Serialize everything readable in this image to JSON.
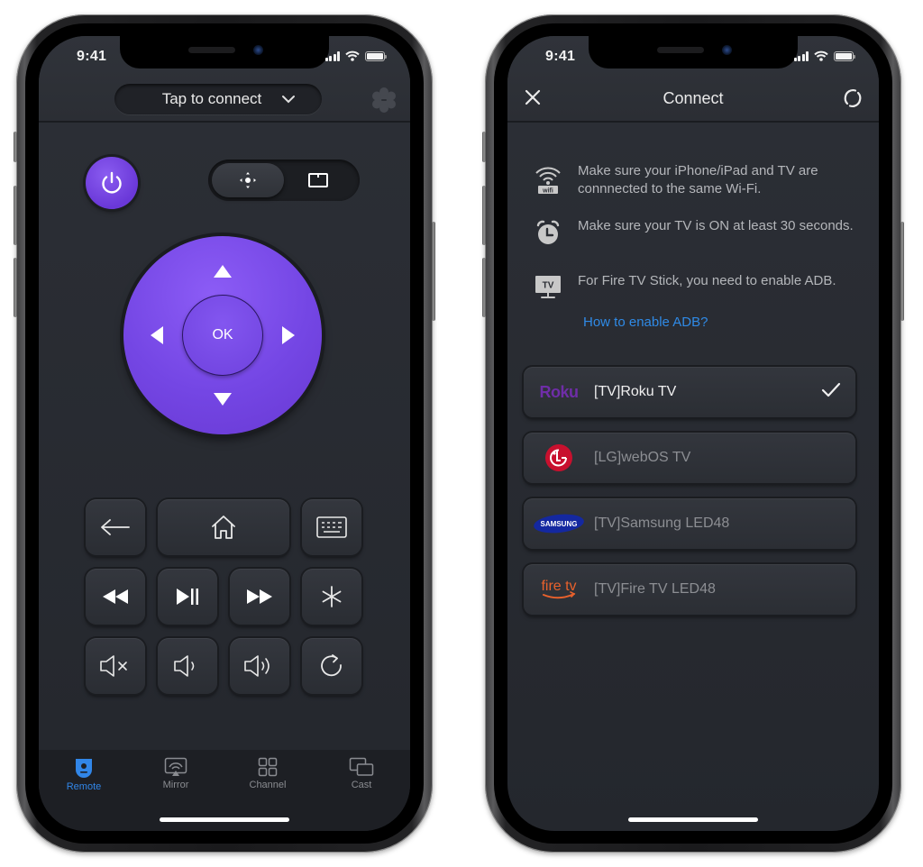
{
  "left_phone": {
    "status_bar": {
      "time": "9:41",
      "battery_level": 1.0
    },
    "header": {
      "connect_label": "Tap to connect",
      "settings_icon": "gear-icon"
    },
    "controls": {
      "power_icon": "power-icon",
      "mode_options": [
        {
          "icon": "dpad-mode-icon",
          "active": true
        },
        {
          "icon": "touchpad-mode-icon",
          "active": false
        }
      ],
      "dpad": {
        "ok_label": "OK"
      },
      "keys": [
        {
          "name": "back",
          "icon": "arrow-left-icon"
        },
        {
          "name": "home",
          "icon": "home-icon"
        },
        {
          "name": "keyboard",
          "icon": "keyboard-icon"
        },
        {
          "name": "rewind",
          "icon": "rewind-icon"
        },
        {
          "name": "play-pause",
          "icon": "play-pause-icon"
        },
        {
          "name": "fast-forward",
          "icon": "fast-forward-icon"
        },
        {
          "name": "options",
          "icon": "asterisk-icon"
        },
        {
          "name": "mute",
          "icon": "mute-icon"
        },
        {
          "name": "volume-down",
          "icon": "volume-down-icon"
        },
        {
          "name": "volume-up",
          "icon": "volume-up-icon"
        },
        {
          "name": "replay",
          "icon": "replay-icon"
        }
      ]
    },
    "tabbar": {
      "tabs": [
        {
          "label": "Remote",
          "icon": "remote-icon",
          "active": true
        },
        {
          "label": "Mirror",
          "icon": "mirror-icon",
          "active": false
        },
        {
          "label": "Channel",
          "icon": "grid-icon",
          "active": false
        },
        {
          "label": "Cast",
          "icon": "cast-icon",
          "active": false
        }
      ]
    },
    "colors": {
      "accent": "#7446e4",
      "tab_active": "#3186e8"
    }
  },
  "right_phone": {
    "status_bar": {
      "time": "9:41",
      "battery_level": 1.0
    },
    "header": {
      "title": "Connect",
      "close_icon": "close-icon",
      "refresh_icon": "refresh-icon"
    },
    "tips": [
      {
        "icon": "wifi-icon",
        "icon_label": "wifi",
        "text": "Make sure your iPhone/iPad and TV are connnected to the same Wi-Fi."
      },
      {
        "icon": "alarm-clock-icon",
        "text": "Make sure your TV is ON at least 30 seconds."
      },
      {
        "icon": "tv-icon",
        "icon_label": "TV",
        "text": "For Fire TV Stick, you need to enable ADB."
      }
    ],
    "adb_link": "How to enable ADB?",
    "devices": [
      {
        "name": "[TV]Roku TV",
        "brand": "Roku",
        "selected": true
      },
      {
        "name": "[LG]webOS TV",
        "brand": "LG",
        "selected": false
      },
      {
        "name": "[TV]Samsung LED48",
        "brand": "SAMSUNG",
        "selected": false
      },
      {
        "name": "[TV]Fire TV LED48",
        "brand": "fire tv",
        "selected": false
      }
    ],
    "colors": {
      "link": "#2f8ae6",
      "roku": "#6f2da8",
      "lg": "#c8102e",
      "samsung": "#1428a0",
      "firetv": "#e8612c"
    }
  }
}
